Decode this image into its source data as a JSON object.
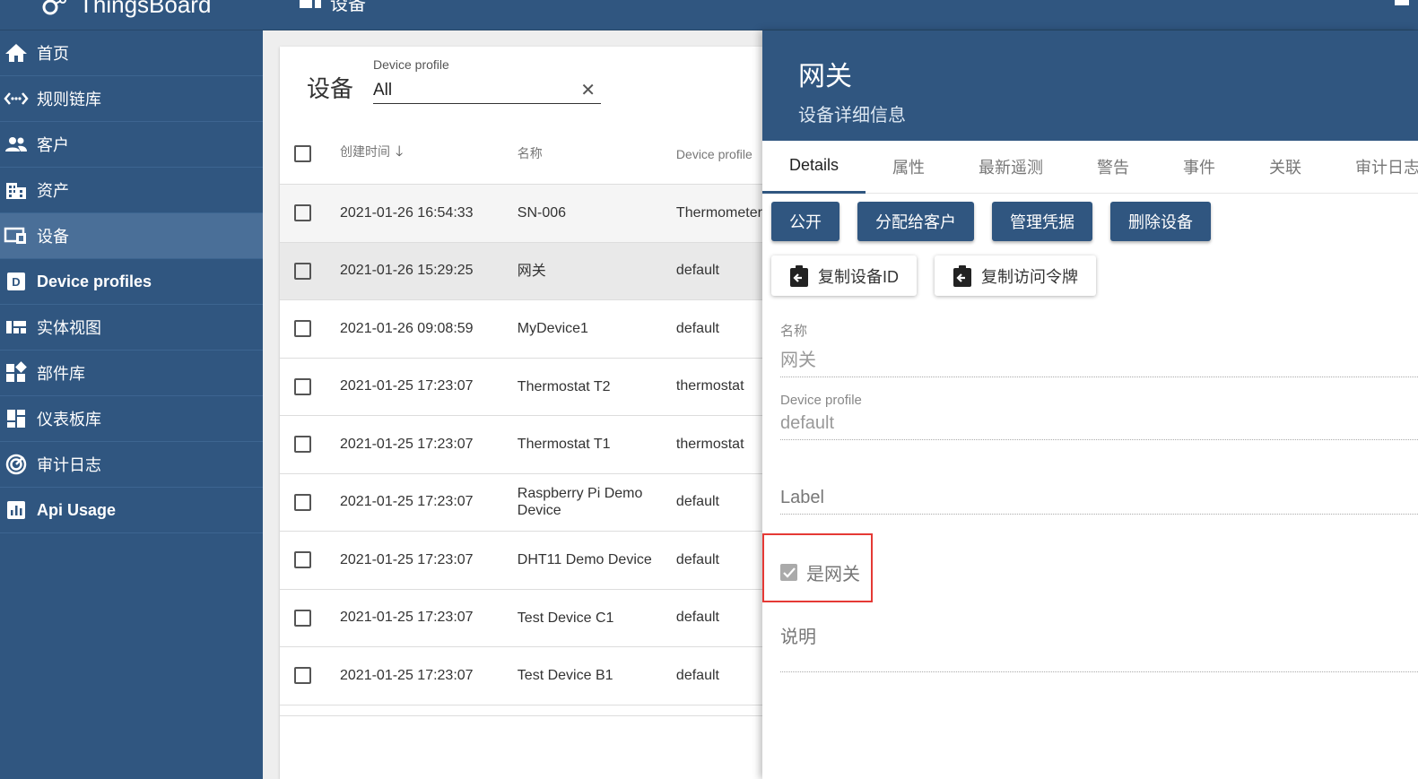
{
  "app": {
    "brand": "ThingsBoard",
    "page_title": "设备"
  },
  "sidebar": {
    "items": [
      {
        "label": "首页",
        "icon": "home-icon"
      },
      {
        "label": "规则链库",
        "icon": "code-arrows-icon"
      },
      {
        "label": "客户",
        "icon": "people-icon"
      },
      {
        "label": "资产",
        "icon": "building-icon"
      },
      {
        "label": "设备",
        "icon": "devices-icon"
      },
      {
        "label": "Device profiles",
        "icon": "device-profile-icon"
      },
      {
        "label": "实体视图",
        "icon": "view-quilt-icon"
      },
      {
        "label": "部件库",
        "icon": "widgets-icon"
      },
      {
        "label": "仪表板库",
        "icon": "dashboard-icon"
      },
      {
        "label": "审计日志",
        "icon": "track-changes-icon"
      },
      {
        "label": "Api Usage",
        "icon": "chart-icon"
      }
    ]
  },
  "list": {
    "title": "设备",
    "filter_label": "Device profile",
    "filter_value": "All",
    "columns": {
      "created": "创建时间",
      "name": "名称",
      "profile": "Device profile"
    },
    "rows": [
      {
        "created": "2021-01-26 16:54:33",
        "name": "SN-006",
        "profile": "Thermometer"
      },
      {
        "created": "2021-01-26 15:29:25",
        "name": "网关",
        "profile": "default"
      },
      {
        "created": "2021-01-26 09:08:59",
        "name": "MyDevice1",
        "profile": "default"
      },
      {
        "created": "2021-01-25 17:23:07",
        "name": "Thermostat T2",
        "profile": "thermostat"
      },
      {
        "created": "2021-01-25 17:23:07",
        "name": "Thermostat T1",
        "profile": "thermostat"
      },
      {
        "created": "2021-01-25 17:23:07",
        "name": "Raspberry Pi Demo Device",
        "profile": "default"
      },
      {
        "created": "2021-01-25 17:23:07",
        "name": "DHT11 Demo Device",
        "profile": "default"
      },
      {
        "created": "2021-01-25 17:23:07",
        "name": "Test Device C1",
        "profile": "default"
      },
      {
        "created": "2021-01-25 17:23:07",
        "name": "Test Device B1",
        "profile": "default"
      }
    ]
  },
  "detail": {
    "title": "网关",
    "subtitle": "设备详细信息",
    "tabs": [
      "Details",
      "属性",
      "最新遥测",
      "警告",
      "事件",
      "关联",
      "审计日志"
    ],
    "buttons": [
      "公开",
      "分配给客户",
      "管理凭据",
      "删除设备"
    ],
    "copy_id": "复制设备ID",
    "copy_token": "复制访问令牌",
    "name_label": "名称",
    "name_value": "网关",
    "profile_label": "Device profile",
    "profile_value": "default",
    "label_placeholder": "Label",
    "gateway_label": "是网关",
    "gateway_checked": true,
    "description_placeholder": "说明"
  },
  "colors": {
    "primary": "#305680",
    "highlight": "#e53935"
  }
}
